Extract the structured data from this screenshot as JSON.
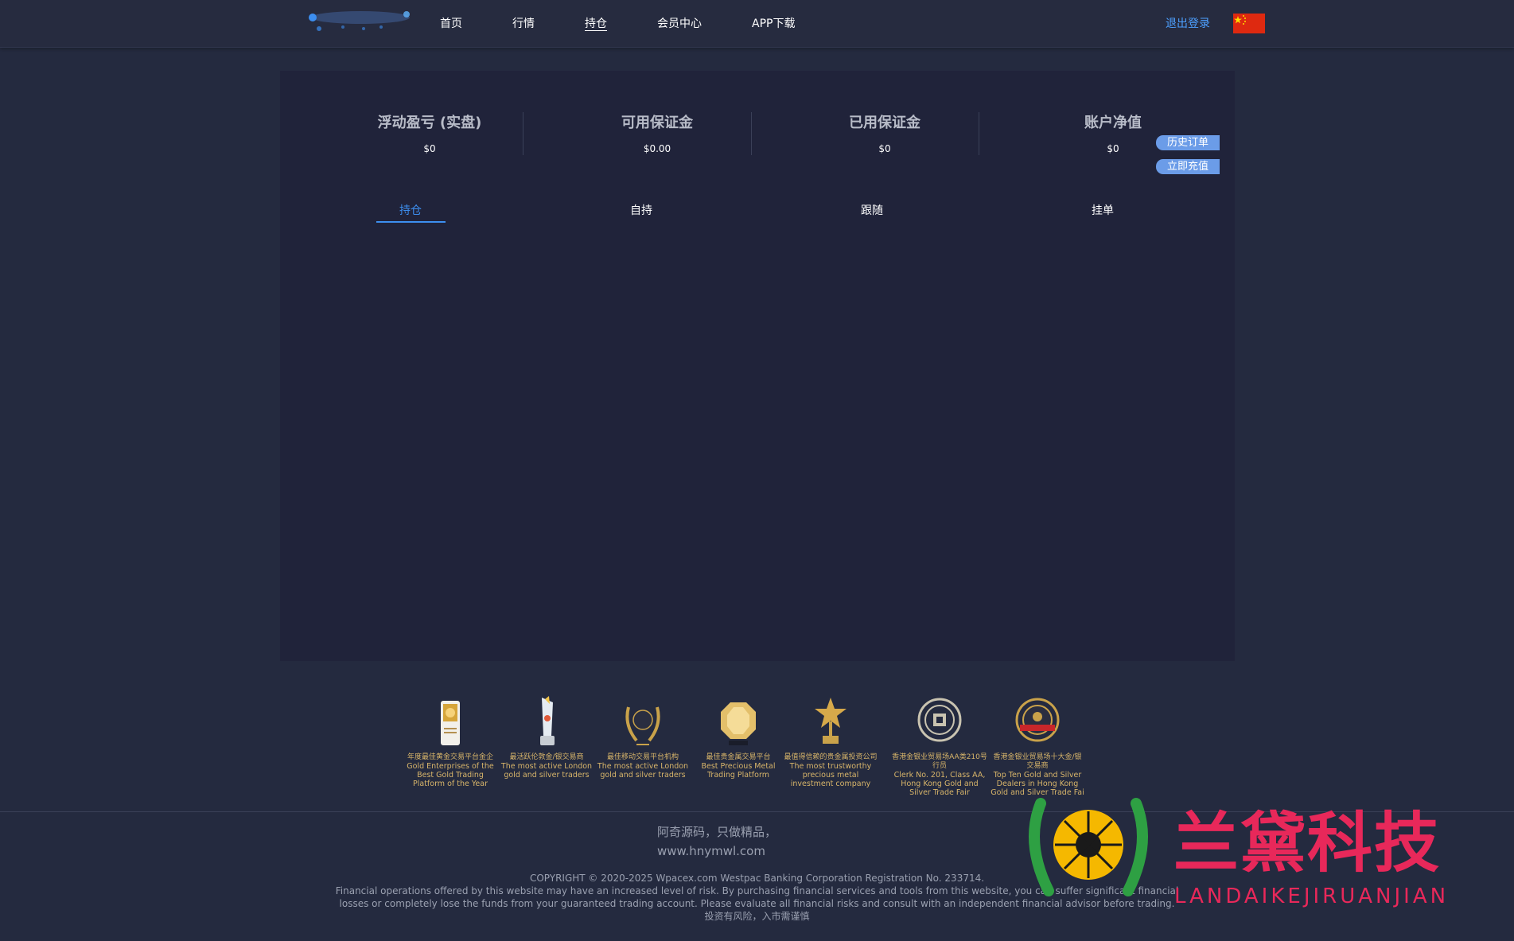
{
  "header": {
    "nav": [
      {
        "label": "首页"
      },
      {
        "label": "行情"
      },
      {
        "label": "持仓"
      },
      {
        "label": "会员中心"
      },
      {
        "label": "APP下载"
      }
    ],
    "active_nav": "持仓",
    "logout_label": "退出登录",
    "flag_icon": "china-flag-icon"
  },
  "stats": [
    {
      "label": "浮动盈亏 (实盘)",
      "value": "$0"
    },
    {
      "label": "可用保证金",
      "value": "$0.00"
    },
    {
      "label": "已用保证金",
      "value": "$0"
    },
    {
      "label": "账户净值",
      "value": "$0"
    }
  ],
  "side_buttons": {
    "history": "历史订单",
    "recharge": "立即充值"
  },
  "tabs": [
    {
      "label": "持仓"
    },
    {
      "label": "自持"
    },
    {
      "label": "跟随"
    },
    {
      "label": "挂单"
    }
  ],
  "awards": [
    {
      "cn": "年度最佳黄金交易平台金企",
      "en": "Gold Enterprises of the Best Gold Trading Platform of the Year"
    },
    {
      "cn": "最活跃伦敦金/银交易商",
      "en": "The most active London gold and silver traders"
    },
    {
      "cn": "最佳移动交易平台机构",
      "en": "The most active London gold and silver traders"
    },
    {
      "cn": "最佳贵金属交易平台",
      "en": "Best Precious Metal Trading Platform"
    },
    {
      "cn": "最值得信赖的贵金属投资公司",
      "en": "The most trustworthy precious metal investment company"
    },
    {
      "cn": "香港金银业贸易场AA类210号行员",
      "en": "Clerk No. 201, Class AA, Hong Kong Gold and Silver Trade Fair"
    },
    {
      "cn": "香港金银业贸易场十大金/银交易商",
      "en": "Top Ten Gold and Silver Dealers in Hong Kong Gold and Silver Trade Fai"
    }
  ],
  "footer": {
    "slogan_line1": "阿奇源码，只做精品，",
    "slogan_line2": "www.hnymwl.com",
    "copyright": "COPYRIGHT © 2020-2025 Wpacex.com Westpac Banking Corporation Registration No. 233714.",
    "risk_text": "Financial operations offered by this website may have an increased level of risk. By purchasing financial services and tools from this website, you can suffer significant financial losses or completely lose the funds from your guaranteed trading account. Please evaluate all financial risks and consult with an independent financial advisor before trading.",
    "risk_cn": "投资有风险，入市需谨慎"
  },
  "watermark": {
    "title": "兰黛科技",
    "subtitle": "LANDAIKEJIRUANJIAN"
  },
  "colors": {
    "accent": "#3d8ff0",
    "side_button": "#6b9ce8",
    "watermark": "#e8285a",
    "award_gold": "#d8b56a"
  }
}
